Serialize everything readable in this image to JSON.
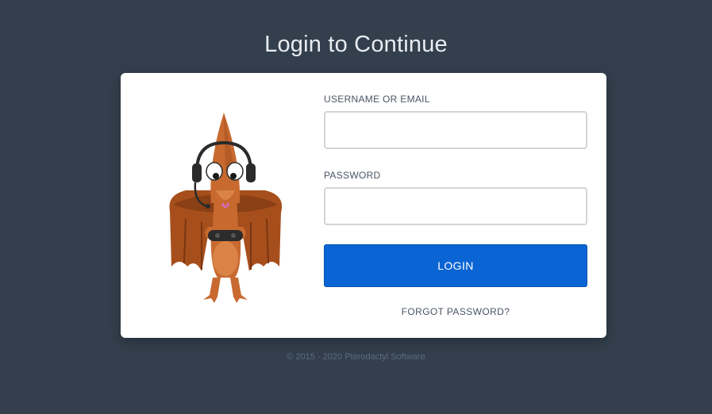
{
  "page": {
    "title": "Login to Continue",
    "footer": "© 2015 - 2020 Pterodactyl Software"
  },
  "form": {
    "username": {
      "label": "USERNAME OR EMAIL",
      "value": ""
    },
    "password": {
      "label": "PASSWORD",
      "value": ""
    },
    "login_label": "LOGIN",
    "forgot_label": "FORGOT PASSWORD?"
  },
  "mascot": {
    "icon": "pterodactyl-gamer-mascot"
  },
  "colors": {
    "background": "#333f4d",
    "card": "#ffffff",
    "accent": "#0a64d3",
    "mascot_body": "#c86a30",
    "mascot_wing": "#a64f1c"
  }
}
